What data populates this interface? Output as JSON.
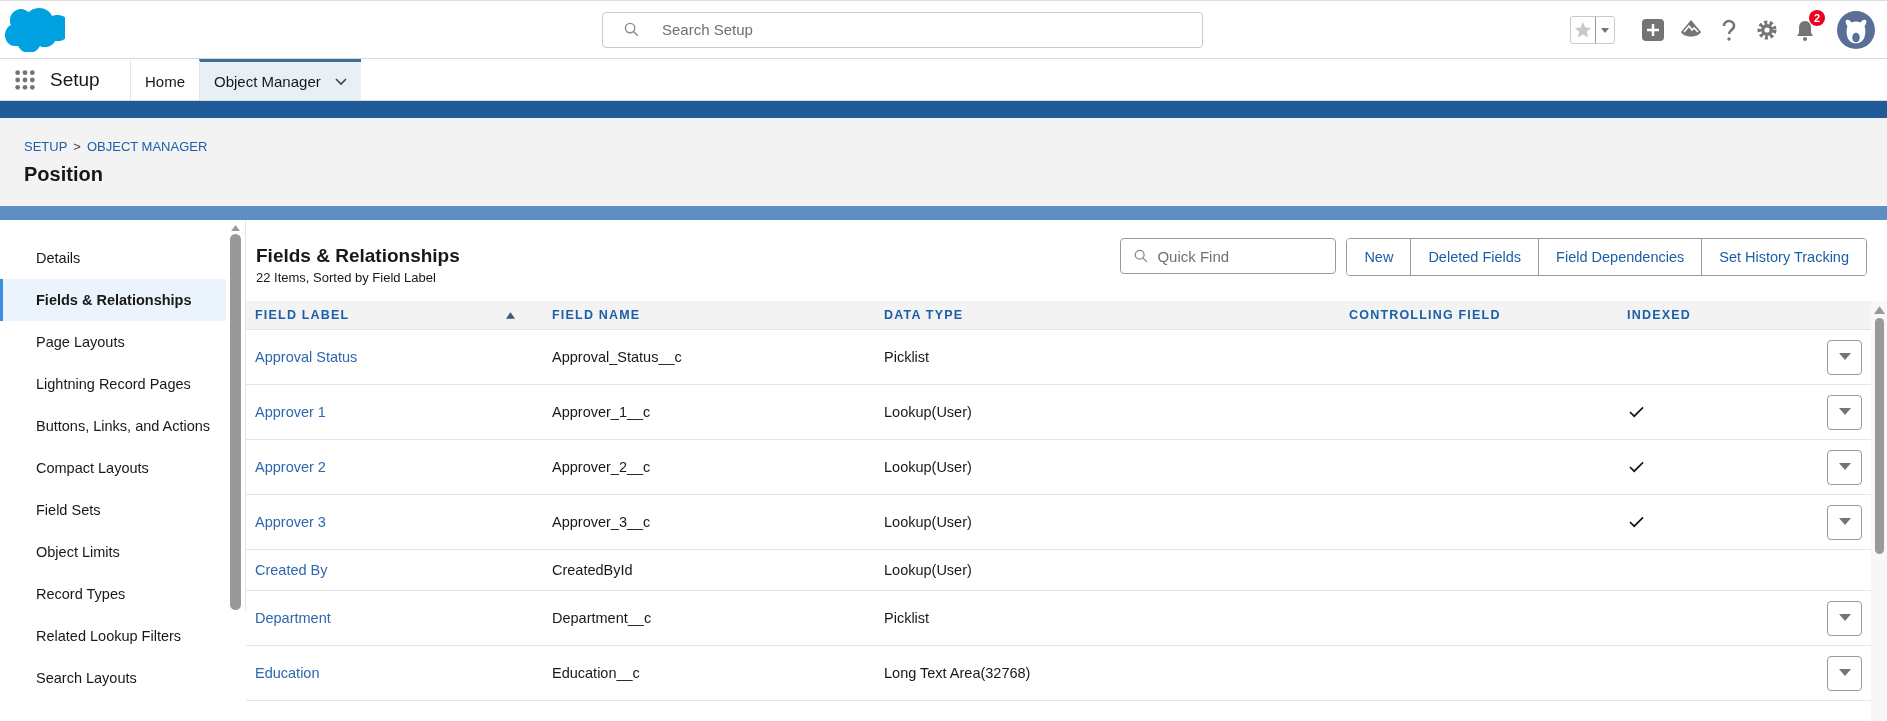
{
  "top_bar": {
    "search": {
      "placeholder": "Search Setup"
    },
    "notifications": {
      "badge": "2"
    }
  },
  "nav": {
    "app_name": "Setup",
    "tabs": [
      {
        "label": "Home",
        "selected": false,
        "dropdown": false
      },
      {
        "label": "Object Manager",
        "selected": true,
        "dropdown": true
      }
    ]
  },
  "header": {
    "breadcrumb": [
      "SETUP",
      ">",
      "OBJECT MANAGER"
    ],
    "title": "Position"
  },
  "sidebar": {
    "items": [
      {
        "label": "Details",
        "selected": false
      },
      {
        "label": "Fields & Relationships",
        "selected": true
      },
      {
        "label": "Page Layouts",
        "selected": false
      },
      {
        "label": "Lightning Record Pages",
        "selected": false
      },
      {
        "label": "Buttons, Links, and Actions",
        "selected": false
      },
      {
        "label": "Compact Layouts",
        "selected": false
      },
      {
        "label": "Field Sets",
        "selected": false
      },
      {
        "label": "Object Limits",
        "selected": false
      },
      {
        "label": "Record Types",
        "selected": false
      },
      {
        "label": "Related Lookup Filters",
        "selected": false
      },
      {
        "label": "Search Layouts",
        "selected": false
      }
    ]
  },
  "main": {
    "title": "Fields & Relationships",
    "subtitle": "22 Items, Sorted by Field Label",
    "quick_find": {
      "placeholder": "Quick Find"
    },
    "buttons": [
      "New",
      "Deleted Fields",
      "Field Dependencies",
      "Set History Tracking"
    ],
    "table": {
      "columns": [
        "FIELD LABEL",
        "FIELD NAME",
        "DATA TYPE",
        "CONTROLLING FIELD",
        "INDEXED"
      ],
      "rows": [
        {
          "label": "Approval Status",
          "name": "Approval_Status__c",
          "type": "Picklist",
          "indexed": false,
          "menu": true
        },
        {
          "label": "Approver 1",
          "name": "Approver_1__c",
          "type": "Lookup(User)",
          "indexed": true,
          "menu": true
        },
        {
          "label": "Approver 2",
          "name": "Approver_2__c",
          "type": "Lookup(User)",
          "indexed": true,
          "menu": true
        },
        {
          "label": "Approver 3",
          "name": "Approver_3__c",
          "type": "Lookup(User)",
          "indexed": true,
          "menu": true
        },
        {
          "label": "Created By",
          "name": "CreatedById",
          "type": "Lookup(User)",
          "indexed": false,
          "menu": false
        },
        {
          "label": "Department",
          "name": "Department__c",
          "type": "Picklist",
          "indexed": false,
          "menu": true
        },
        {
          "label": "Education",
          "name": "Education__c",
          "type": "Long Text Area(32768)",
          "indexed": false,
          "menu": true
        }
      ]
    }
  }
}
